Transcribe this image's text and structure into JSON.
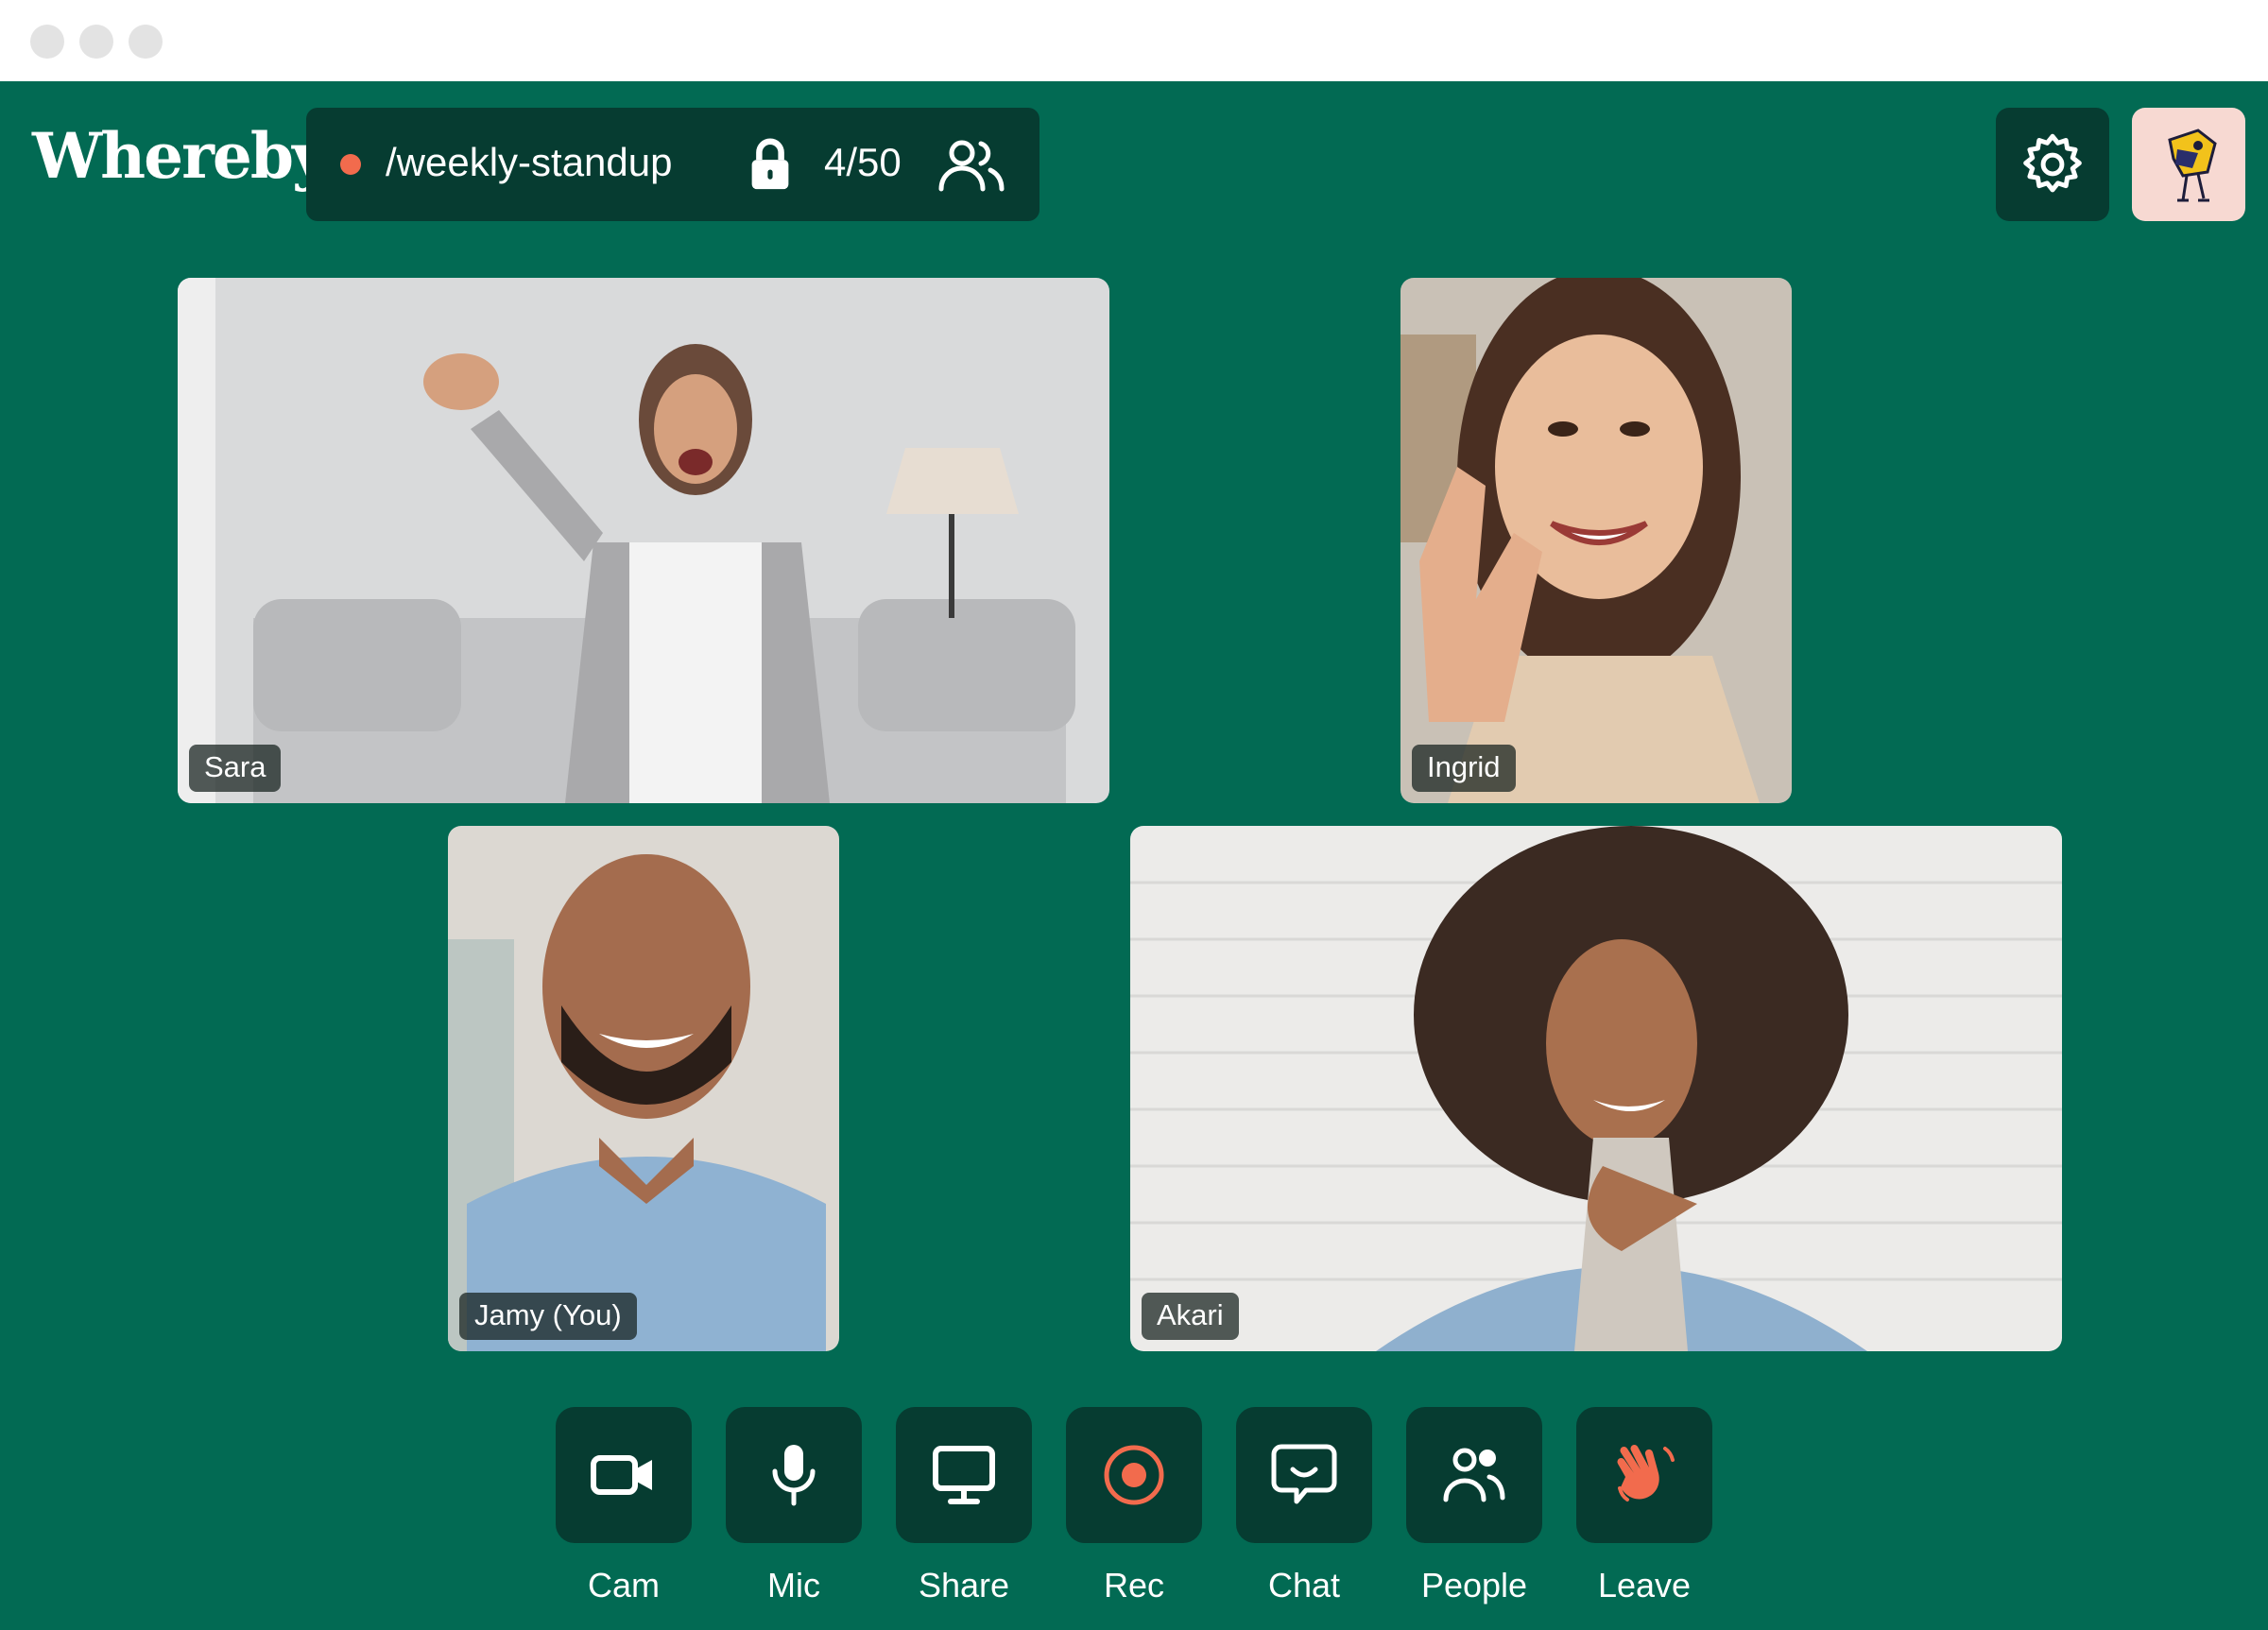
{
  "window": {
    "controls": [
      "close-dot",
      "minimize-dot",
      "maximize-dot"
    ]
  },
  "header": {
    "logo": "Whereby",
    "room": {
      "name": "/weekly-standup",
      "participant_count": "4/50",
      "status_dot_color": "#f26b4d",
      "locked": true
    },
    "icons": [
      "lock-icon",
      "people-icon",
      "gear-icon",
      "avatar"
    ]
  },
  "participants": [
    {
      "name": "Sara"
    },
    {
      "name": "Ingrid"
    },
    {
      "name": "Jamy (You)"
    },
    {
      "name": "Akari"
    }
  ],
  "toolbar": {
    "buttons": [
      {
        "label": "Cam",
        "icon": "camera-icon"
      },
      {
        "label": "Mic",
        "icon": "microphone-icon"
      },
      {
        "label": "Share",
        "icon": "screen-share-icon"
      },
      {
        "label": "Rec",
        "icon": "record-icon"
      },
      {
        "label": "Chat",
        "icon": "chat-icon"
      },
      {
        "label": "People",
        "icon": "people-icon"
      },
      {
        "label": "Leave",
        "icon": "wave-hand-icon"
      }
    ]
  },
  "colors": {
    "background": "#026a53",
    "panel": "#063c31",
    "accent": "#f26b4d",
    "avatar_bg": "#f7d9d2"
  }
}
